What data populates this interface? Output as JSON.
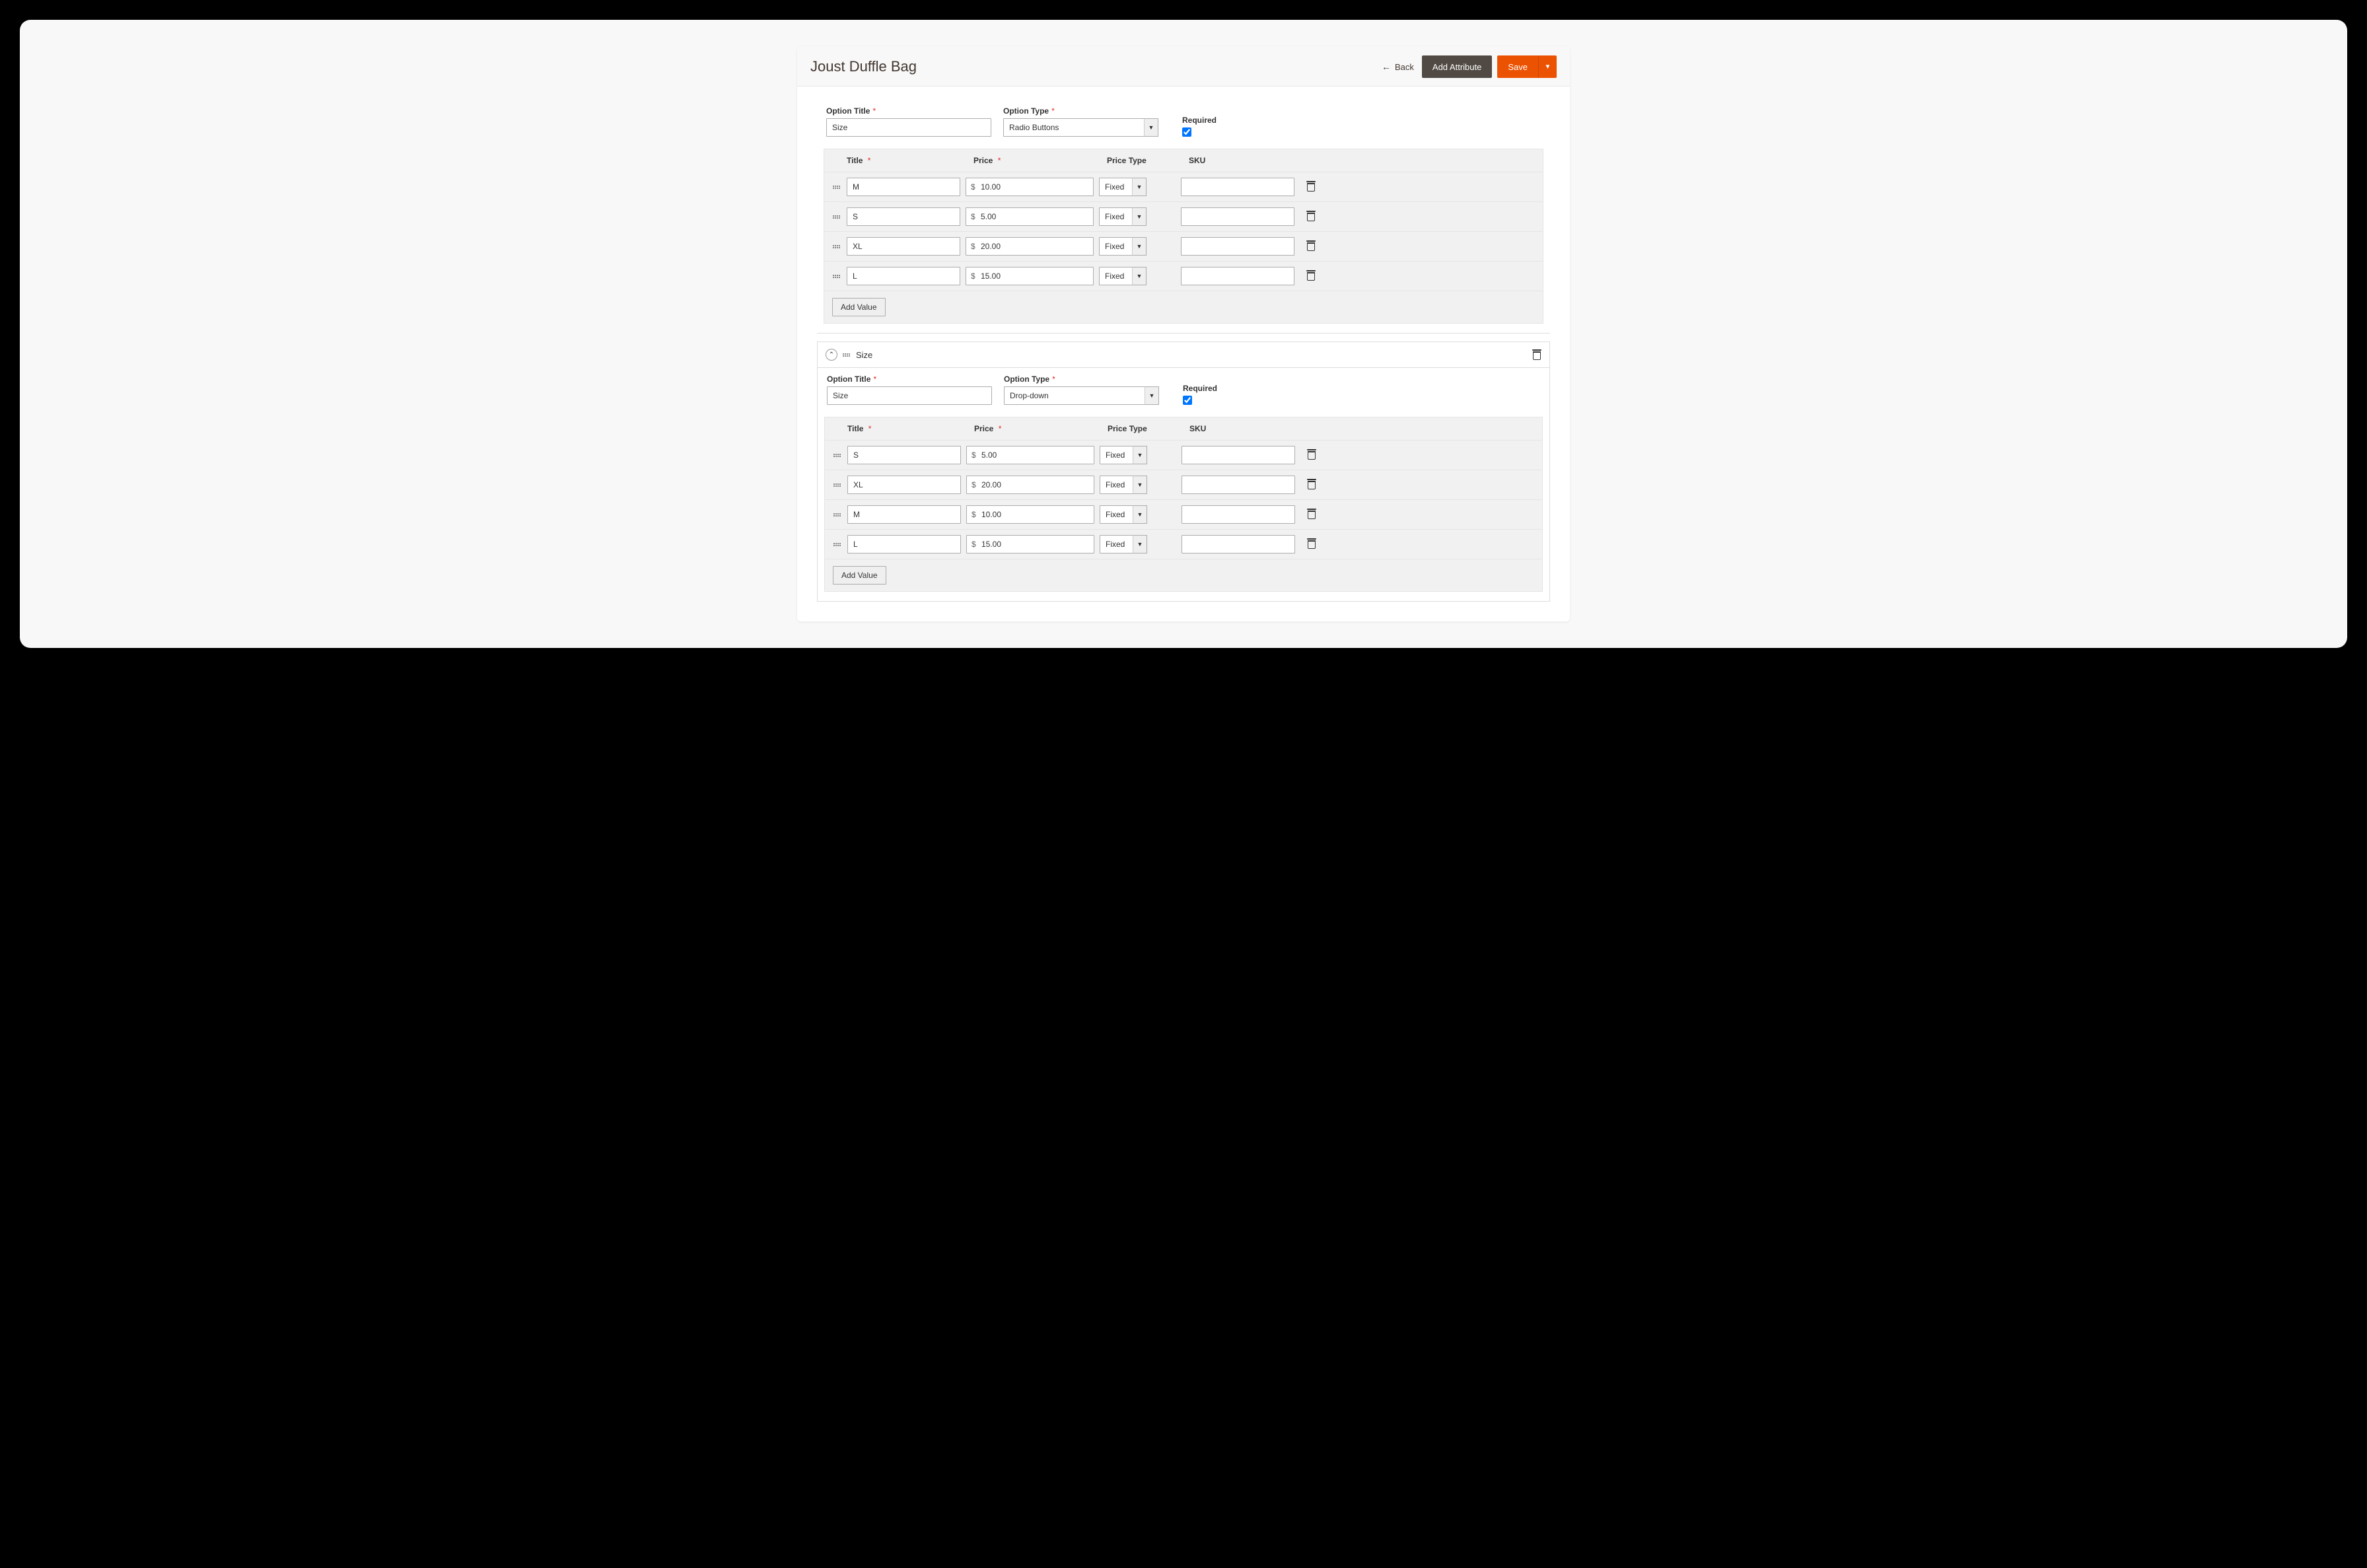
{
  "header": {
    "title": "Joust Duffle Bag",
    "back_label": "Back",
    "add_attribute_label": "Add Attribute",
    "save_label": "Save"
  },
  "labels": {
    "option_title": "Option Title",
    "option_type": "Option Type",
    "required": "Required",
    "col_title": "Title",
    "col_price": "Price",
    "col_price_type": "Price Type",
    "col_sku": "SKU",
    "add_value": "Add Value",
    "currency": "$"
  },
  "options": [
    {
      "title": "Size",
      "type": "Radio Buttons",
      "required": true,
      "show_header": false,
      "values": [
        {
          "title": "M",
          "price": "10.00",
          "price_type": "Fixed",
          "sku": ""
        },
        {
          "title": "S",
          "price": "5.00",
          "price_type": "Fixed",
          "sku": ""
        },
        {
          "title": "XL",
          "price": "20.00",
          "price_type": "Fixed",
          "sku": ""
        },
        {
          "title": "L",
          "price": "15.00",
          "price_type": "Fixed",
          "sku": ""
        }
      ]
    },
    {
      "title": "Size",
      "type": "Drop-down",
      "required": true,
      "show_header": true,
      "values": [
        {
          "title": "S",
          "price": "5.00",
          "price_type": "Fixed",
          "sku": ""
        },
        {
          "title": "XL",
          "price": "20.00",
          "price_type": "Fixed",
          "sku": ""
        },
        {
          "title": "M",
          "price": "10.00",
          "price_type": "Fixed",
          "sku": ""
        },
        {
          "title": "L",
          "price": "15.00",
          "price_type": "Fixed",
          "sku": ""
        }
      ]
    }
  ]
}
